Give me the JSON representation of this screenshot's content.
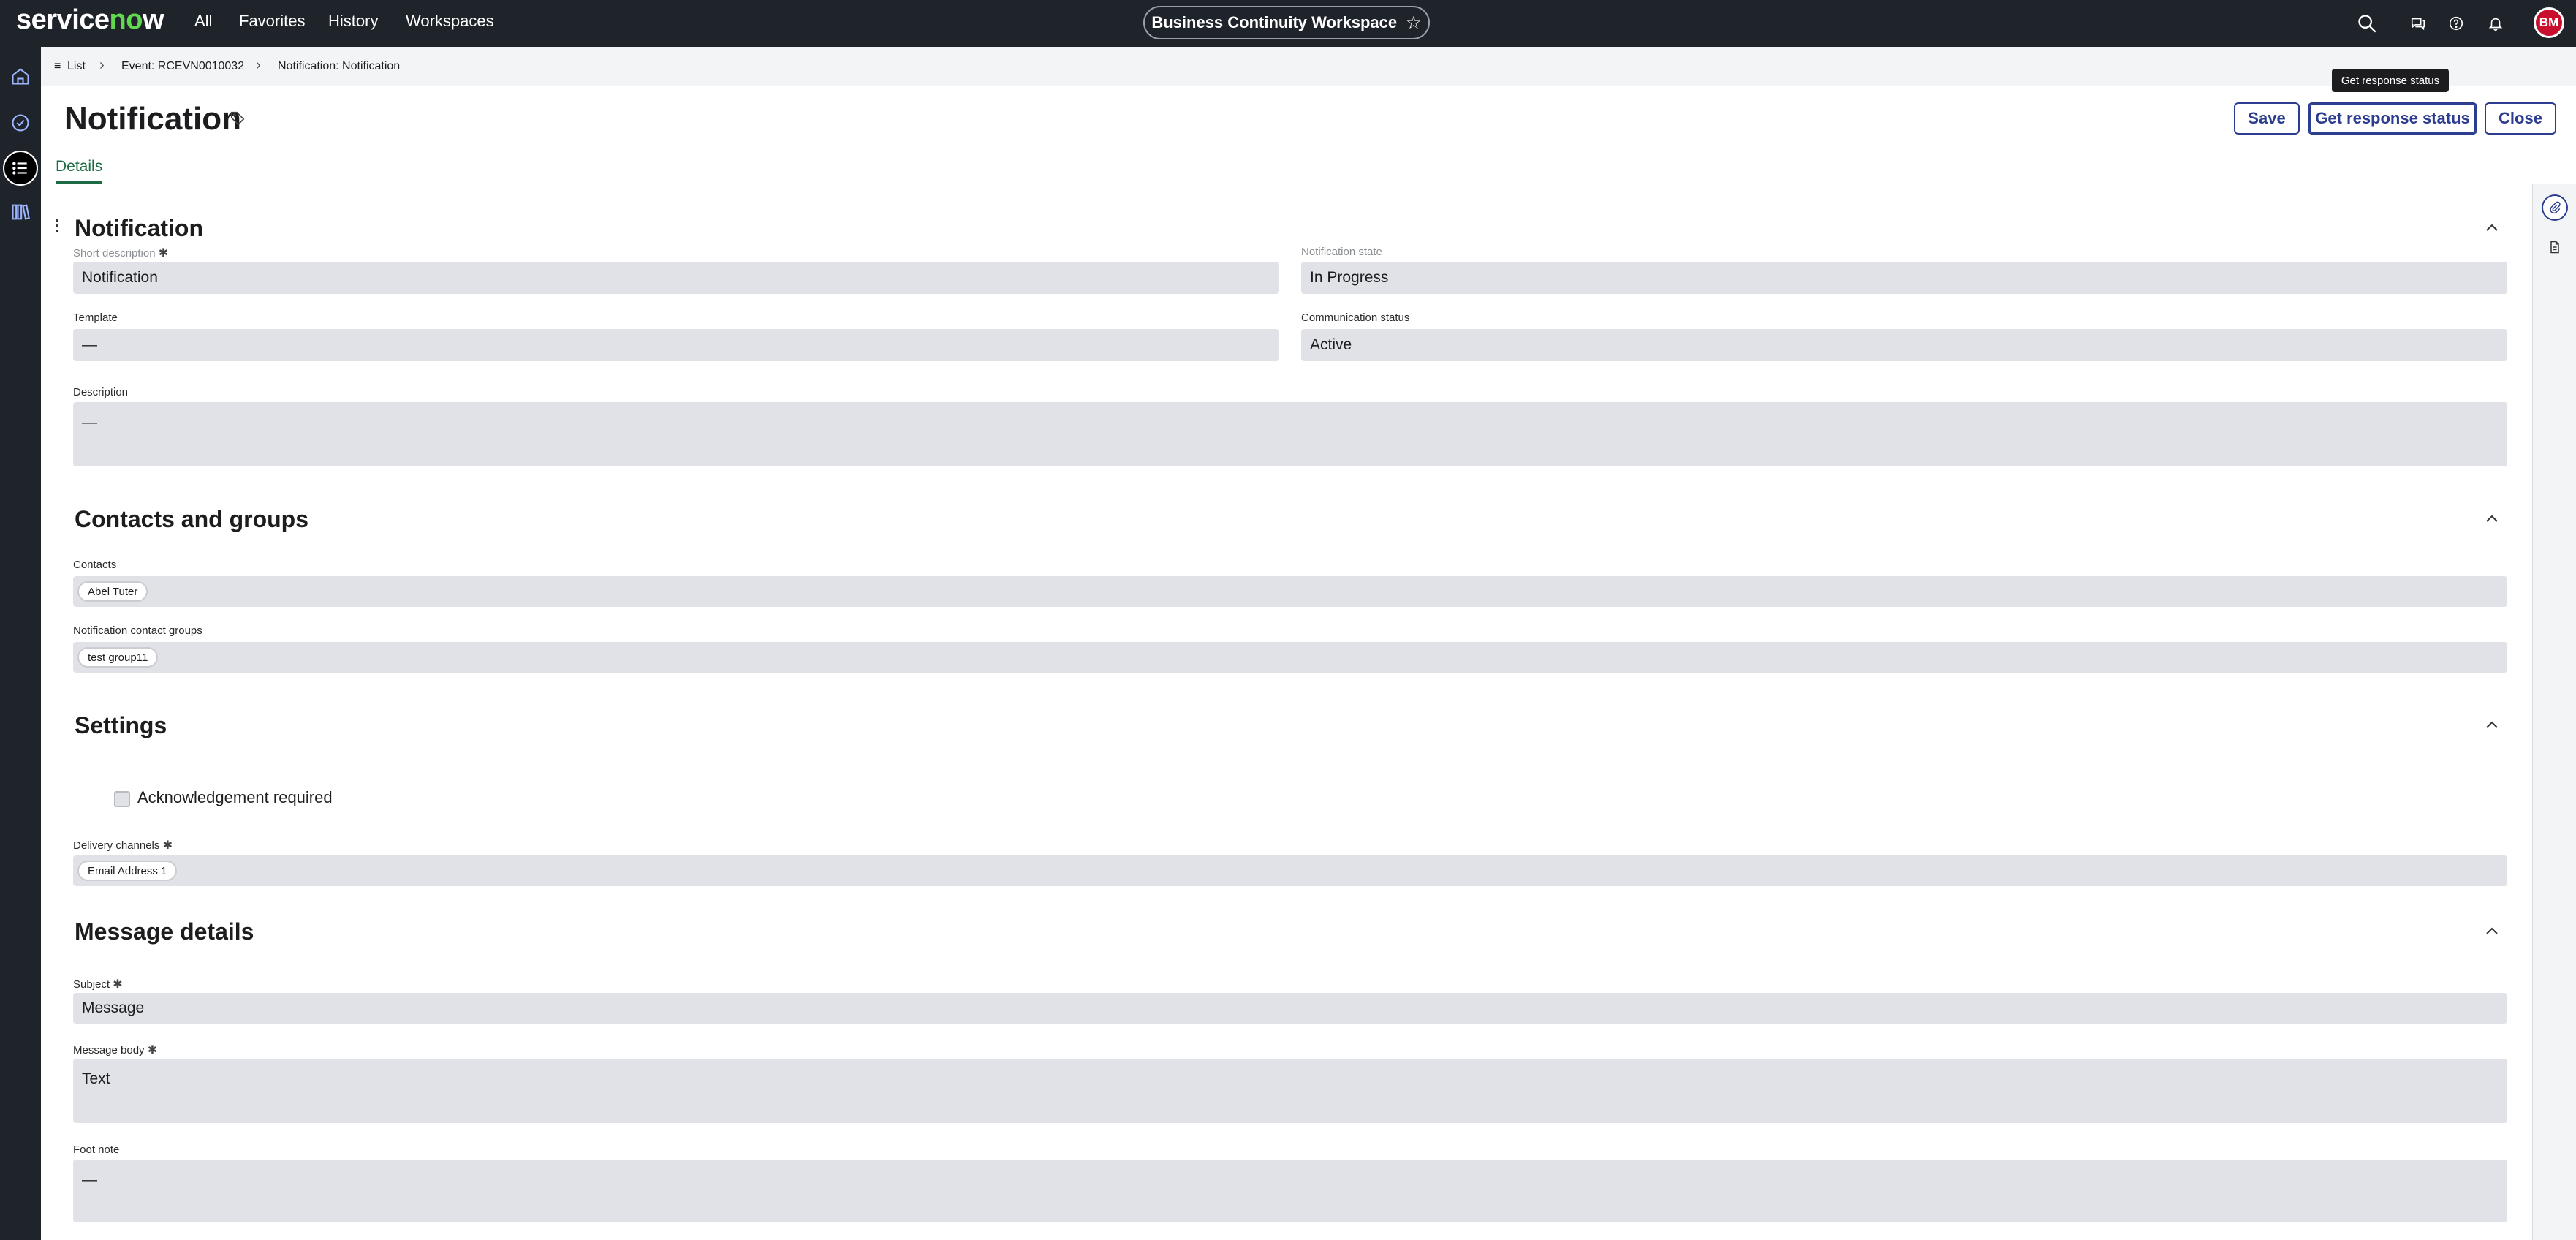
{
  "topnav": {
    "logo": "servicenow",
    "links": [
      "All",
      "Favorites",
      "History",
      "Workspaces"
    ],
    "workspace": "Business Continuity Workspace",
    "avatar_initials": "BM"
  },
  "breadcrumb": {
    "list": "List",
    "event": "Event: RCEVN0010032",
    "current": "Notification: Notification"
  },
  "header": {
    "title": "Notification",
    "save_label": "Save",
    "response_label": "Get response status",
    "close_label": "Close",
    "tooltip": "Get response status",
    "tab": "Details"
  },
  "sections": {
    "notification": {
      "title": "Notification",
      "short_description_label": "Short description",
      "short_description": "Notification",
      "notification_state_label": "Notification state",
      "notification_state": "In Progress",
      "template_label": "Template",
      "template": "—",
      "communication_status_label": "Communication status",
      "communication_status": "Active",
      "description_label": "Description",
      "description": "—"
    },
    "contacts": {
      "title": "Contacts and groups",
      "contacts_label": "Contacts",
      "contacts": [
        "Abel Tuter"
      ],
      "groups_label": "Notification contact groups",
      "groups": [
        "test group11"
      ]
    },
    "settings": {
      "title": "Settings",
      "ack_label": "Acknowledgement required",
      "delivery_label": "Delivery channels",
      "delivery": [
        "Email Address 1"
      ]
    },
    "message": {
      "title": "Message details",
      "subject_label": "Subject",
      "subject": "Message",
      "body_label": "Message body",
      "body": "Text",
      "footnote_label": "Foot note",
      "footnote": "—"
    }
  },
  "colors": {
    "nav_bg": "#1f242a",
    "brand_green": "#62d84e",
    "button_blue": "#2c3d8f",
    "tab_green": "#1c6b45",
    "field_bg": "#e1e2e7"
  }
}
